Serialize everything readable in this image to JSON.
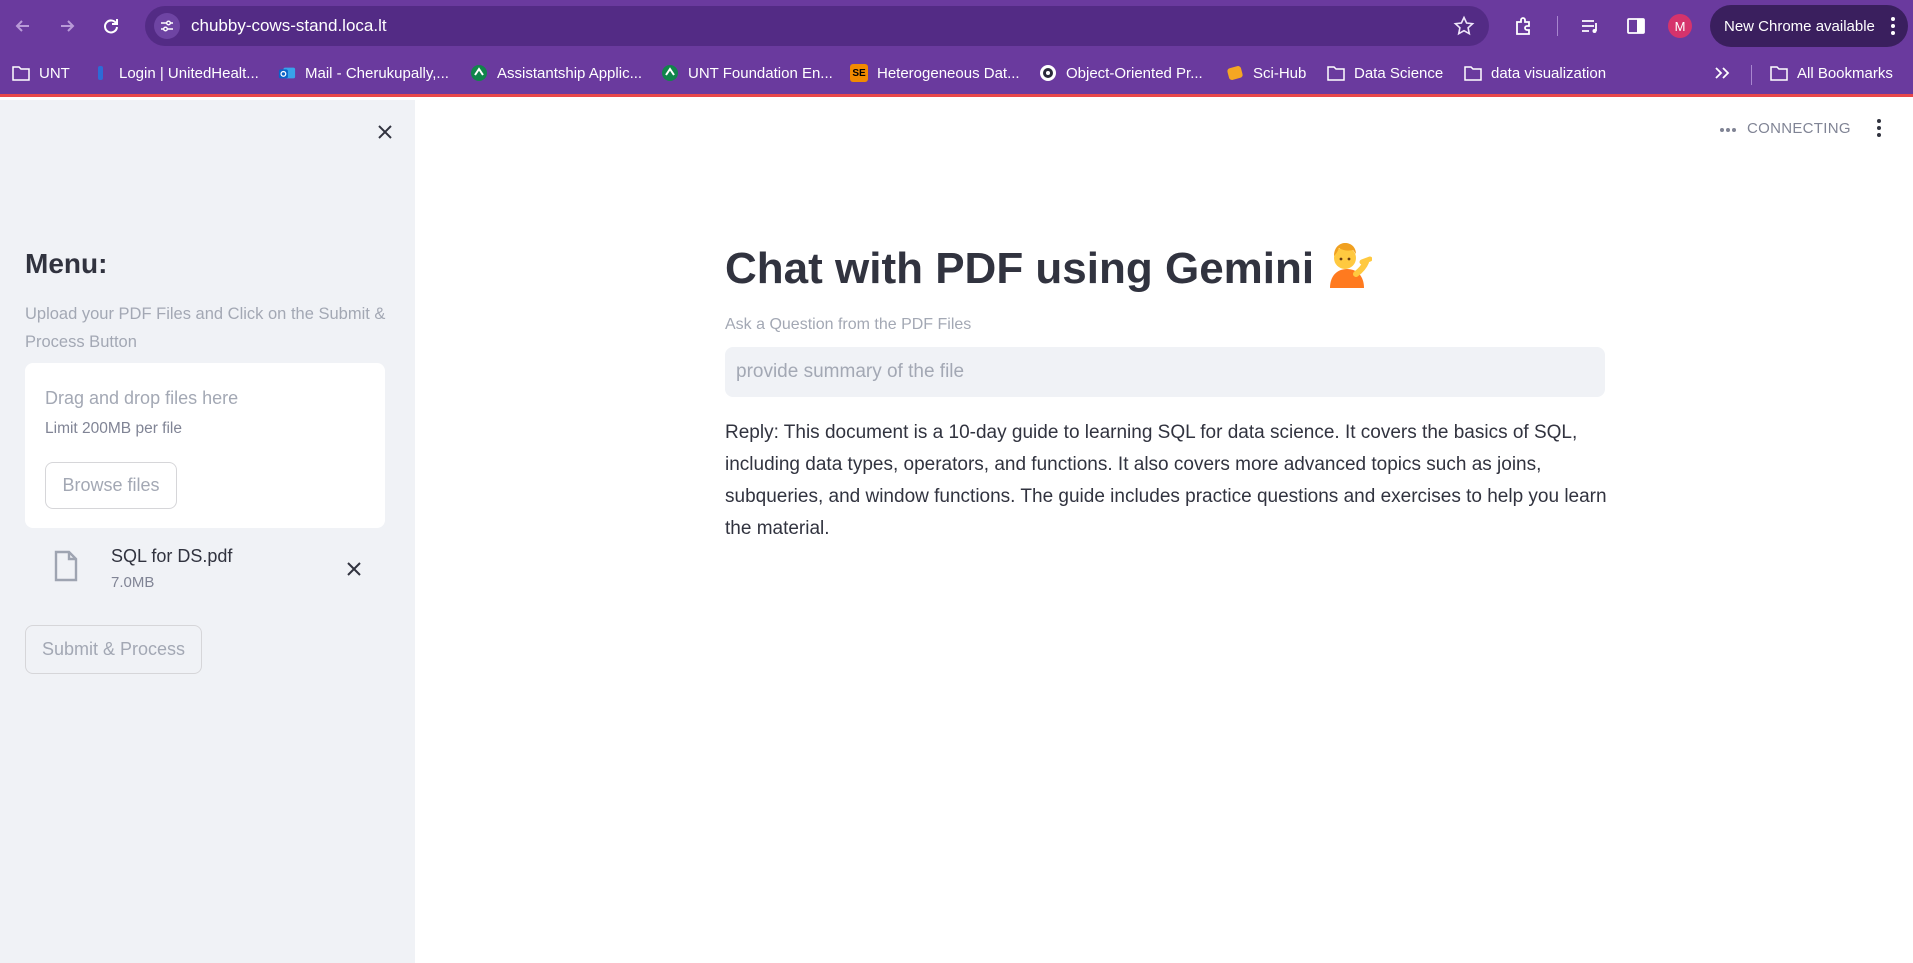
{
  "browser": {
    "url": "chubby-cows-stand.loca.lt",
    "profile_initial": "M",
    "update_label": "New Chrome available",
    "icons": [
      "back-icon",
      "forward-icon",
      "reload-icon",
      "site-info-icon",
      "star-icon",
      "extensions-icon",
      "media-queue-icon",
      "side-panel-icon",
      "kebab-menu-icon"
    ]
  },
  "bookmarks": {
    "items": [
      {
        "label": "UNT",
        "icon": "folder-icon"
      },
      {
        "label": "Login | UnitedHealt...",
        "icon": "site-favicon"
      },
      {
        "label": "Mail - Cherukupally,...",
        "icon": "outlook-icon"
      },
      {
        "label": "Assistantship Applic...",
        "icon": "site-favicon"
      },
      {
        "label": "UNT Foundation En...",
        "icon": "site-favicon"
      },
      {
        "label": "Heterogeneous Dat...",
        "icon": "se-icon"
      },
      {
        "label": "Object-Oriented Pr...",
        "icon": "site-favicon"
      },
      {
        "label": "Sci-Hub",
        "icon": "site-favicon"
      },
      {
        "label": "Data Science",
        "icon": "folder-icon"
      },
      {
        "label": "data visualization",
        "icon": "folder-icon"
      }
    ],
    "all_bookmarks_label": "All Bookmarks"
  },
  "sidebar": {
    "title": "Menu:",
    "help_text": "Upload your PDF Files and Click on the Submit & Process Button",
    "dropzone": {
      "title": "Drag and drop files here",
      "limit": "Limit 200MB per file",
      "browse_label": "Browse files"
    },
    "file": {
      "name": "SQL for DS.pdf",
      "size": "7.0MB"
    },
    "submit_label": "Submit & Process"
  },
  "main": {
    "status": "CONNECTING",
    "title": "Chat with PDF using Gemini",
    "question_label": "Ask a Question from the PDF Files",
    "question_value": "provide summary of the file",
    "reply": "Reply: This document is a 10-day guide to learning SQL for data science. It covers the basics of SQL, including data types, operators, and functions. It also covers more advanced topics such as joins, subqueries, and window functions. The guide includes practice questions and exercises to help you learn the material."
  }
}
